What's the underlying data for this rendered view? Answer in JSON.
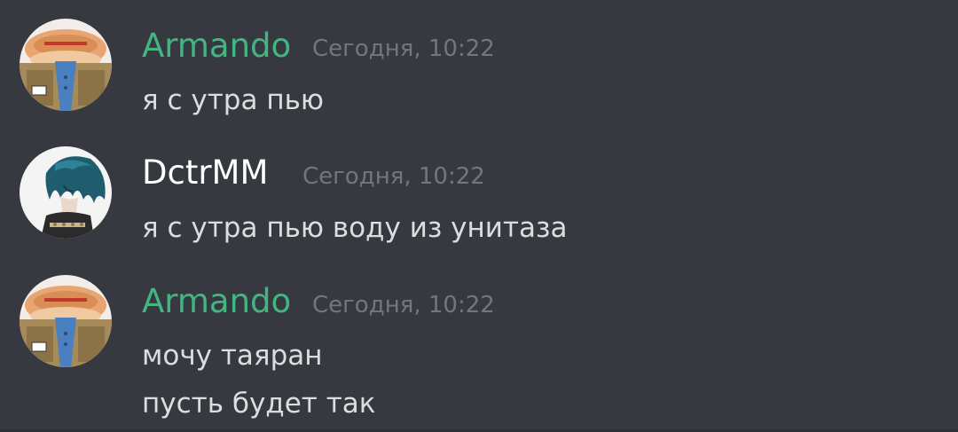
{
  "messages": [
    {
      "author": "Armando",
      "author_color": "#43b581",
      "avatar_icon": "cat-avatar-icon",
      "timestamp": "Сегодня, 10:22",
      "lines": [
        "я с утра пью"
      ]
    },
    {
      "author": "DctrMM",
      "author_color": "#ffffff",
      "avatar_icon": "anime-character-avatar-icon",
      "timestamp": "Сегодня, 10:22",
      "lines": [
        "я с утра пью воду из унитаза"
      ]
    },
    {
      "author": "Armando",
      "author_color": "#43b581",
      "avatar_icon": "cat-avatar-icon",
      "timestamp": "Сегодня, 10:22",
      "lines": [
        "мочу таяран",
        "пусть будет так"
      ]
    }
  ],
  "theme": {
    "background": "#36393f",
    "timestamp_color": "#72767d",
    "text_color": "#dcddde"
  }
}
